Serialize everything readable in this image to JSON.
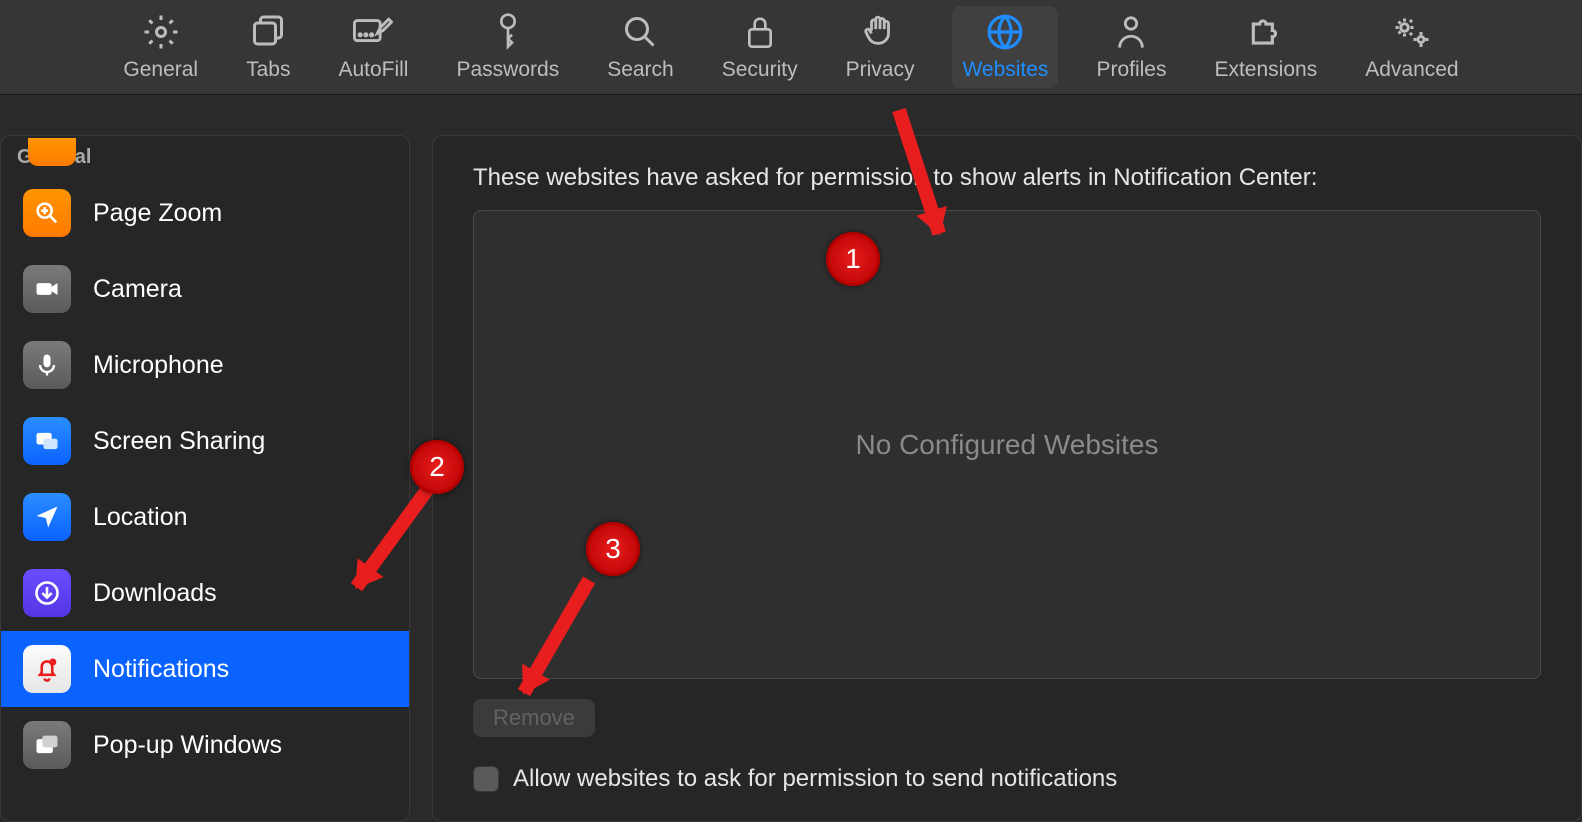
{
  "toolbar": {
    "items": [
      {
        "label": "General"
      },
      {
        "label": "Tabs"
      },
      {
        "label": "AutoFill"
      },
      {
        "label": "Passwords"
      },
      {
        "label": "Search"
      },
      {
        "label": "Security"
      },
      {
        "label": "Privacy"
      },
      {
        "label": "Websites"
      },
      {
        "label": "Profiles"
      },
      {
        "label": "Extensions"
      },
      {
        "label": "Advanced"
      }
    ],
    "active_index": 7
  },
  "sidebar": {
    "section": "General",
    "items": [
      {
        "label": "Page Zoom"
      },
      {
        "label": "Camera"
      },
      {
        "label": "Microphone"
      },
      {
        "label": "Screen Sharing"
      },
      {
        "label": "Location"
      },
      {
        "label": "Downloads"
      },
      {
        "label": "Notifications"
      },
      {
        "label": "Pop-up Windows"
      }
    ],
    "selected_index": 6
  },
  "main": {
    "description": "These websites have asked for permission to show alerts in Notification Center:",
    "empty_text": "No Configured Websites",
    "remove_label": "Remove",
    "allow_label": "Allow websites to ask for permission to send notifications",
    "allow_checked": false
  },
  "annotations": {
    "markers": [
      "1",
      "2",
      "3"
    ]
  }
}
